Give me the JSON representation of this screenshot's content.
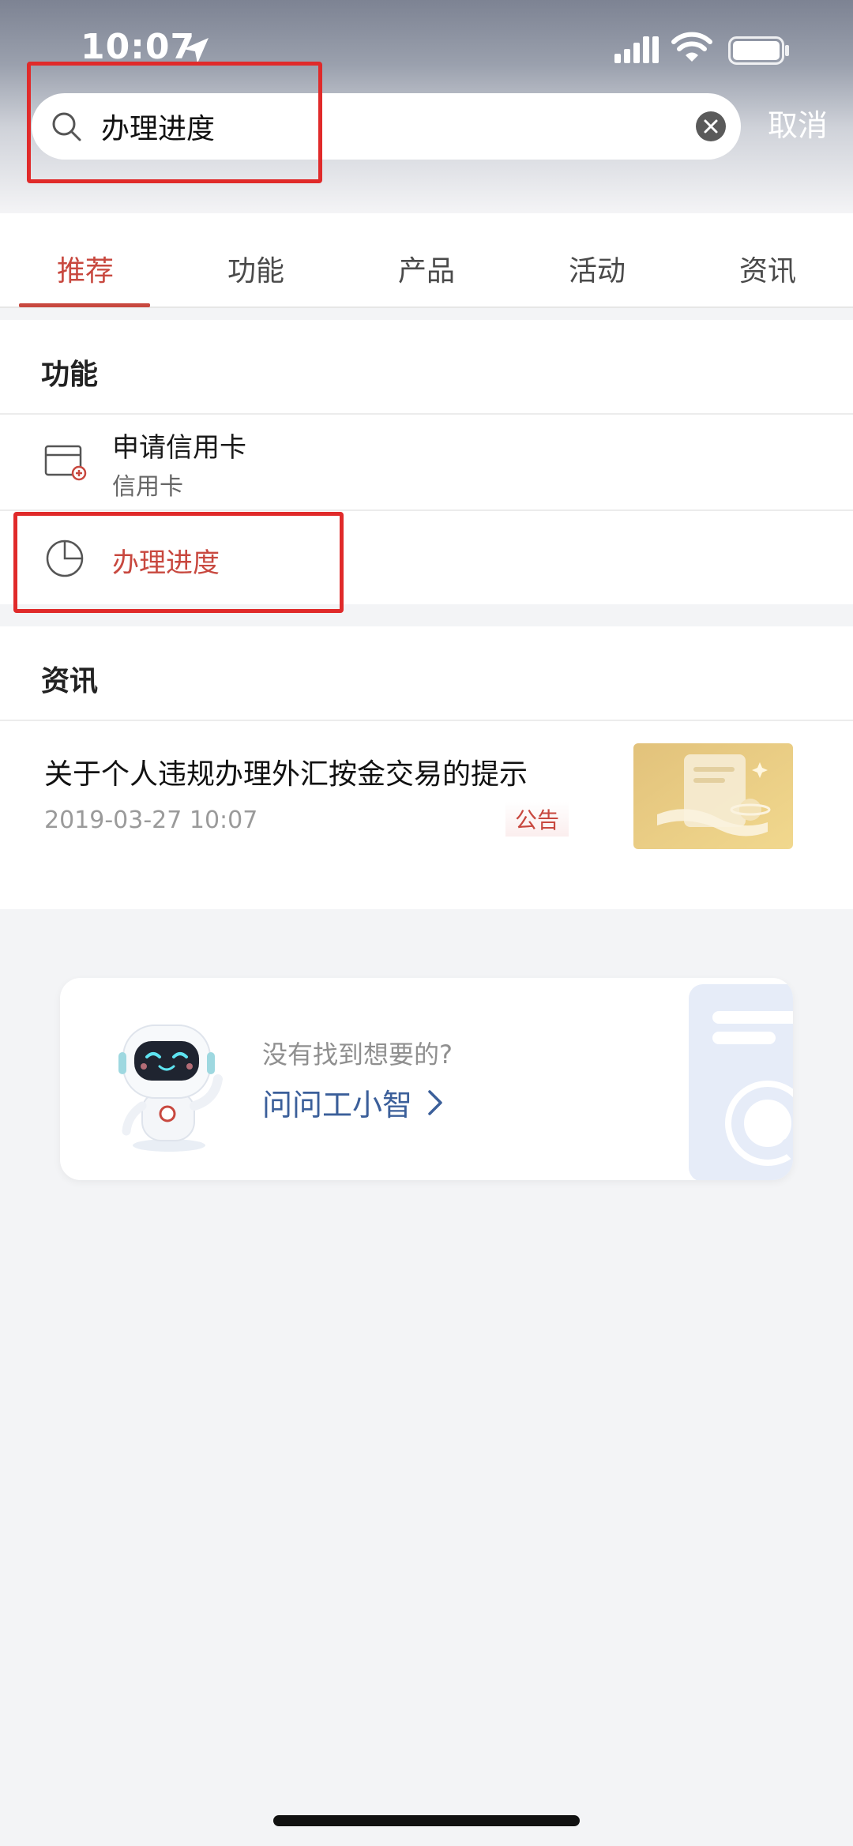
{
  "status_bar": {
    "time": "10:07"
  },
  "search": {
    "query": "办理进度",
    "cancel_label": "取消"
  },
  "tabs": [
    {
      "label": "推荐",
      "active": true
    },
    {
      "label": "功能",
      "active": false
    },
    {
      "label": "产品",
      "active": false
    },
    {
      "label": "活动",
      "active": false
    },
    {
      "label": "资讯",
      "active": false
    }
  ],
  "functions": {
    "title": "功能",
    "items": [
      {
        "title": "申请信用卡",
        "subtitle": "信用卡",
        "icon": "credit-card-add-icon"
      },
      {
        "title": "办理进度",
        "icon": "pie-chart-icon"
      }
    ]
  },
  "news": {
    "title": "资讯",
    "items": [
      {
        "title": "关于个人违规办理外汇按金交易的提示",
        "date": "2019-03-27 10:07",
        "badge": "公告"
      }
    ]
  },
  "helper": {
    "question": "没有找到想要的?",
    "link_label": "问问工小智"
  },
  "colors": {
    "accent": "#c8483f",
    "link": "#3b5f9a",
    "highlight": "#e02a2a"
  }
}
